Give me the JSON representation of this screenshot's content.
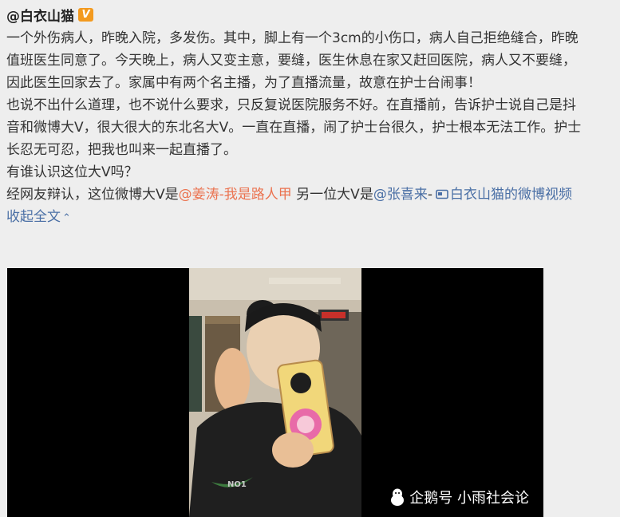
{
  "post": {
    "author": "@白衣山猫",
    "verified_badge": "V",
    "lines": [
      "一个外伤病人，昨晚入院，多发伤。其中，脚上有一个3cm的小伤口，病人自己拒绝缝合，昨晚",
      "值班医生同意了。今天晚上，病人又变主意，要缝，医生休息在家又赶回医院，病人又不要缝，",
      "因此医生回家去了。家属中有两个名主播，为了直播流量，故意在护士台闹事！",
      "也说不出什么道理，也不说什么要求，只反复说医院服务不好。在直播前，告诉护士说自己是抖",
      "音和微博大V，很大很大的东北名大V。一直在直播，闹了护士台很久，护士根本无法工作。护士",
      "长忍无可忍，把我也叫来一起直播了。",
      "有谁认识这位大V吗？"
    ],
    "last_line": {
      "prefix": "经网友辩认，这位微博大V是",
      "mention1": "@姜涛",
      "mention1_suffix": "-我是路人甲",
      "middle": " 另一位大V是",
      "mention2": "@张喜来",
      "mention2_suffix": "-",
      "video_link": "白衣山猫的微博视频"
    },
    "collapse_label": "收起全文"
  },
  "video": {
    "shirt_text": "NO1"
  },
  "watermark": {
    "text": "企鹅号 小雨社会论"
  },
  "colors": {
    "mention": "#eb7350",
    "link": "#4a6fa5",
    "badge": "#f39a1f",
    "background": "#eeeeee"
  }
}
